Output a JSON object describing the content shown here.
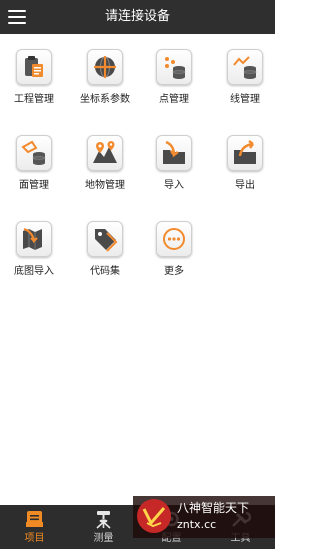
{
  "header": {
    "title": "请连接设备",
    "menu_icon": "menu-icon"
  },
  "tiles": [
    {
      "label": "工程管理",
      "icon": "clipboard-icon"
    },
    {
      "label": "坐标系参数",
      "icon": "globe-icon"
    },
    {
      "label": "点管理",
      "icon": "points-database-icon"
    },
    {
      "label": "线管理",
      "icon": "line-database-icon"
    },
    {
      "label": "面管理",
      "icon": "surface-database-icon"
    },
    {
      "label": "地物管理",
      "icon": "map-pin-icon"
    },
    {
      "label": "导入",
      "icon": "import-folder-icon"
    },
    {
      "label": "导出",
      "icon": "export-folder-icon"
    },
    {
      "label": "底图导入",
      "icon": "base-map-icon"
    },
    {
      "label": "代码集",
      "icon": "tag-icon"
    },
    {
      "label": "更多",
      "icon": "more-icon"
    }
  ],
  "tabbar": {
    "tabs": [
      {
        "label": "项目",
        "icon": "project-icon",
        "active": true
      },
      {
        "label": "测量",
        "icon": "survey-icon",
        "active": false
      },
      {
        "label": "配置",
        "icon": "config-icon",
        "active": false
      },
      {
        "label": "工具",
        "icon": "tools-icon",
        "active": false
      }
    ]
  },
  "watermark": {
    "line1": "八神智能天下",
    "line2": "zntx.cc"
  },
  "colors": {
    "header_bg": "#2f2f2f",
    "accent": "#f08a24",
    "tabbar_bg": "#2d2d2d"
  }
}
